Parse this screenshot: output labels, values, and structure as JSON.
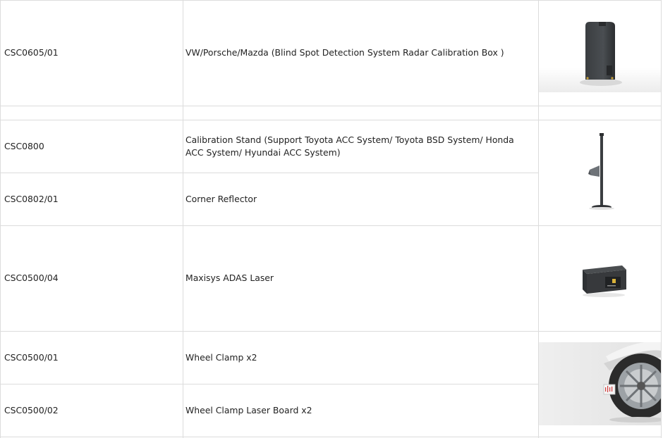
{
  "rows": [
    {
      "code": "CSC0605/01",
      "description": "VW/Porsche/Mazda (Blind Spot Detection System Radar Calibration Box )",
      "image": "radar-calibration-box"
    },
    {
      "code": "",
      "description": "",
      "image": ""
    },
    {
      "code": "CSC0800",
      "description": "Calibration Stand (Support Toyota ACC System/ Toyota BSD System/ Honda ACC System/ Hyundai ACC System)",
      "image": "calibration-stand"
    },
    {
      "code": "CSC0802/01",
      "description": "Corner Reflector",
      "image": ""
    },
    {
      "code": "CSC0500/04",
      "description": "Maxisys ADAS Laser",
      "image": "adas-laser-box"
    },
    {
      "code": "CSC0500/01",
      "description": "Wheel Clamp x2",
      "image": "wheel-clamp-photo"
    },
    {
      "code": "CSC0500/02",
      "description": "Wheel Clamp Laser Board x2",
      "image": ""
    }
  ]
}
